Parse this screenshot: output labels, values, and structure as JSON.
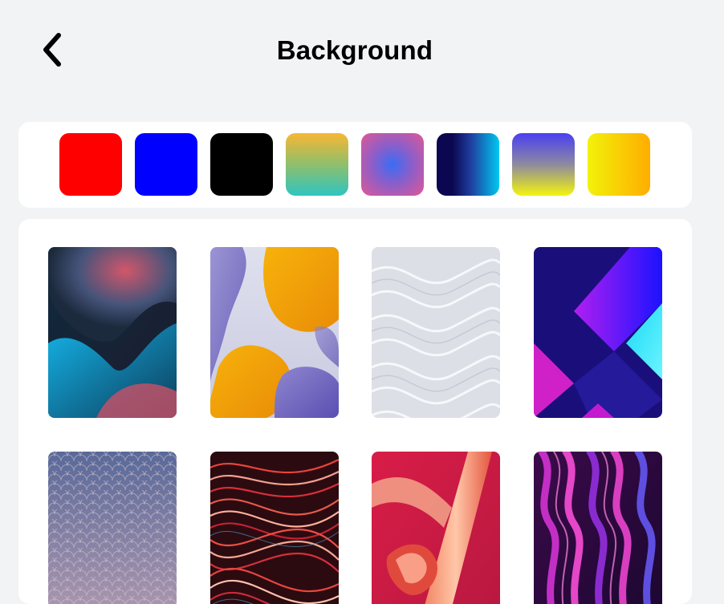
{
  "header": {
    "title": "Background",
    "back_icon": "chevron-left-icon"
  },
  "colors": {
    "red": "#ff0000",
    "blue": "#0000ff",
    "black": "#000000",
    "amber_teal": [
      "#f7b733",
      "#2ec4c0"
    ],
    "pink_blue_radial": [
      "#3a6cf5",
      "#e05896"
    ],
    "navy_cyan": [
      "#0b0750",
      "#00c8f0"
    ],
    "indigo_yellow": [
      "#4a3ff0",
      "#f4f40e"
    ],
    "yellow_orange": [
      "#f2f20a",
      "#ffad00"
    ]
  },
  "swatches": [
    {
      "name": "red"
    },
    {
      "name": "blue"
    },
    {
      "name": "black"
    },
    {
      "name": "amber-teal-gradient"
    },
    {
      "name": "pink-blue-radial-gradient"
    },
    {
      "name": "navy-cyan-gradient"
    },
    {
      "name": "indigo-yellow-gradient"
    },
    {
      "name": "yellow-orange-gradient"
    }
  ],
  "wallpapers": [
    {
      "name": "teal-blob-wallpaper"
    },
    {
      "name": "orange-purple-blob-wallpaper"
    },
    {
      "name": "white-wave-wallpaper"
    },
    {
      "name": "purple-geometric-wallpaper"
    },
    {
      "name": "scale-pattern-wallpaper"
    },
    {
      "name": "red-swirl-lines-wallpaper"
    },
    {
      "name": "red-3d-tubes-wallpaper"
    },
    {
      "name": "magenta-wave-wallpaper"
    }
  ]
}
